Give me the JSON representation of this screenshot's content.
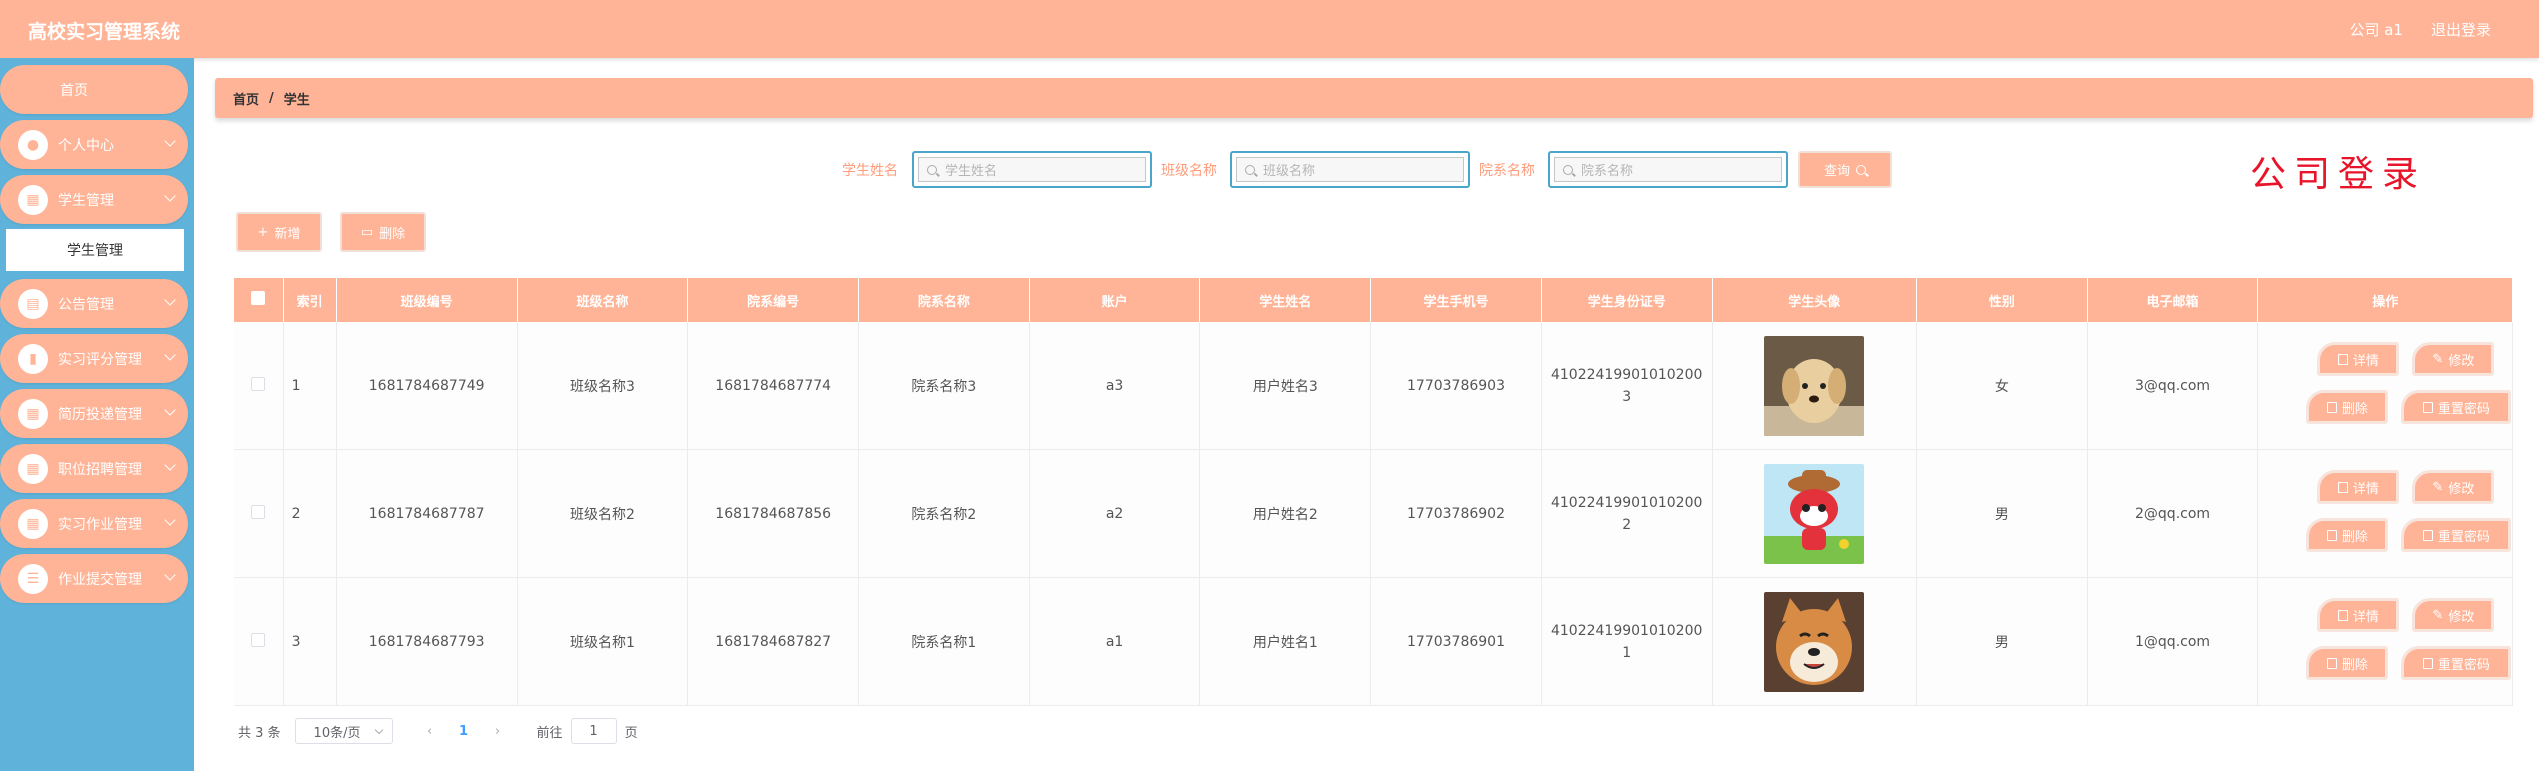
{
  "header": {
    "title": "高校实习管理系统",
    "user_label": "公司 a1",
    "logout_label": "退出登录"
  },
  "sidebar": {
    "home_label": "首页",
    "items": [
      {
        "label": "个人中心",
        "icon": "user-icon"
      },
      {
        "label": "学生管理",
        "icon": "grid-icon"
      },
      {
        "label": "公告管理",
        "icon": "chat-icon"
      },
      {
        "label": "实习评分管理",
        "icon": "clipboard-icon"
      },
      {
        "label": "简历投递管理",
        "icon": "grid-icon"
      },
      {
        "label": "职位招聘管理",
        "icon": "grid-icon"
      },
      {
        "label": "实习作业管理",
        "icon": "grid-icon"
      },
      {
        "label": "作业提交管理",
        "icon": "list-icon"
      }
    ],
    "sub_item_label": "学生管理"
  },
  "breadcrumb": {
    "home": "首页",
    "separator": "/",
    "current": "学生"
  },
  "search": {
    "student_name_label": "学生姓名",
    "student_name_placeholder": "学生姓名",
    "class_name_label": "班级名称",
    "class_name_placeholder": "班级名称",
    "dept_name_label": "院系名称",
    "dept_name_placeholder": "院系名称",
    "query_label": "查询"
  },
  "banner_text": "公司登录",
  "actions": {
    "add_label": "新增",
    "delete_label": "删除"
  },
  "table": {
    "headers": [
      "",
      "索引",
      "班级编号",
      "班级名称",
      "院系编号",
      "院系名称",
      "账户",
      "学生姓名",
      "学生手机号",
      "学生身份证号",
      "学生头像",
      "性别",
      "电子邮箱",
      "操作"
    ],
    "rows": [
      {
        "index": "1",
        "class_no": "1681784687749",
        "class_name": "班级名称3",
        "dept_no": "1681784687774",
        "dept_name": "院系名称3",
        "account": "a3",
        "student_name": "用户姓名3",
        "phone": "17703786903",
        "id_line1": "41022419901010200",
        "id_line2": "3",
        "avatar": "puppy-photo",
        "gender": "女",
        "email": "3@qq.com"
      },
      {
        "index": "2",
        "class_no": "1681784687787",
        "class_name": "班级名称2",
        "dept_no": "1681784687856",
        "dept_name": "院系名称2",
        "account": "a2",
        "student_name": "用户姓名2",
        "phone": "17703786902",
        "id_line1": "41022419901010200",
        "id_line2": "2",
        "avatar": "cartoon-fox",
        "gender": "男",
        "email": "2@qq.com"
      },
      {
        "index": "3",
        "class_no": "1681784687793",
        "class_name": "班级名称1",
        "dept_no": "1681784687827",
        "dept_name": "院系名称1",
        "account": "a1",
        "student_name": "用户姓名1",
        "phone": "17703786901",
        "id_line1": "41022419901010200",
        "id_line2": "1",
        "avatar": "shiba-photo",
        "gender": "男",
        "email": "1@qq.com"
      }
    ],
    "op_labels": {
      "detail": "详情",
      "edit": "修改",
      "delete": "删除",
      "reset_pwd": "重置密码"
    }
  },
  "pagination": {
    "total_text": "共 3 条",
    "page_size": "10条/页",
    "current_page": "1",
    "goto_label": "前往",
    "goto_value": "1",
    "page_suffix": "页"
  },
  "colors": {
    "accent": "#ffb497",
    "sidebar_bg": "#5fb2d9",
    "banner_red": "#e8142a"
  }
}
